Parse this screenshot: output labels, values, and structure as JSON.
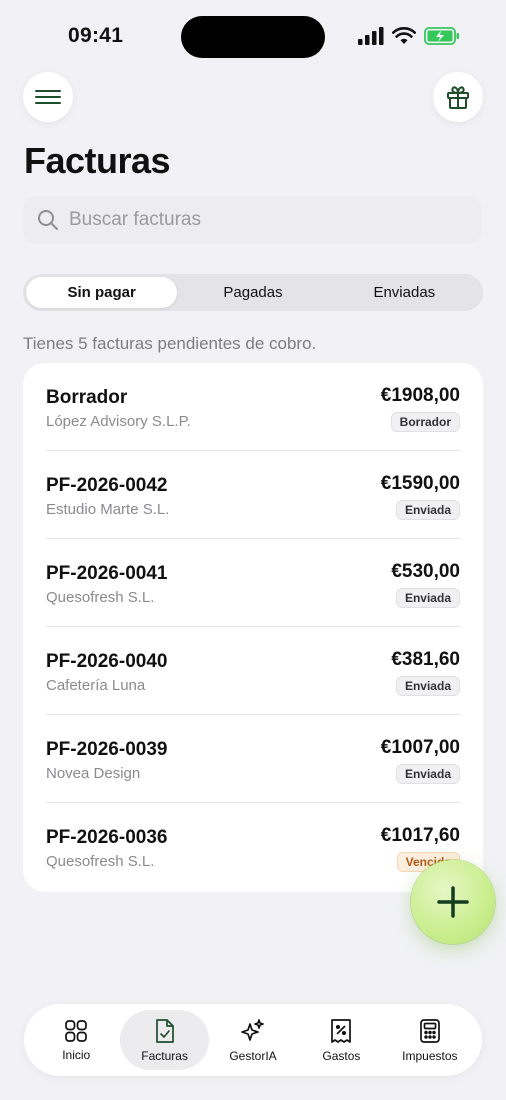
{
  "status_bar": {
    "time": "09:41"
  },
  "header": {
    "title": "Facturas"
  },
  "search": {
    "placeholder": "Buscar facturas"
  },
  "segments": [
    {
      "label": "Sin pagar",
      "active": true
    },
    {
      "label": "Pagadas",
      "active": false
    },
    {
      "label": "Enviadas",
      "active": false
    }
  ],
  "summary_text": "Tienes 5 facturas pendientes de cobro.",
  "invoices": [
    {
      "number": "Borrador",
      "client": "López Advisory S.L.P.",
      "amount": "€1908,00",
      "status": "Borrador"
    },
    {
      "number": "PF-2026-0042",
      "client": "Estudio Marte S.L.",
      "amount": "€1590,00",
      "status": "Enviada"
    },
    {
      "number": "PF-2026-0041",
      "client": "Quesofresh S.L.",
      "amount": "€530,00",
      "status": "Enviada"
    },
    {
      "number": "PF-2026-0040",
      "client": "Cafetería Luna",
      "amount": "€381,60",
      "status": "Enviada"
    },
    {
      "number": "PF-2026-0039",
      "client": "Novea Design",
      "amount": "€1007,00",
      "status": "Enviada"
    },
    {
      "number": "PF-2026-0036",
      "client": "Quesofresh S.L.",
      "amount": "€1017,60",
      "status": "Vencida"
    }
  ],
  "tabbar": [
    {
      "label": "Inicio",
      "icon": "grid-icon",
      "active": false
    },
    {
      "label": "Facturas",
      "icon": "invoice-icon",
      "active": true
    },
    {
      "label": "GestorIA",
      "icon": "sparkles-icon",
      "active": false
    },
    {
      "label": "Gastos",
      "icon": "receipt-icon",
      "active": false
    },
    {
      "label": "Impuestos",
      "icon": "calculator-icon",
      "active": false
    }
  ],
  "colors": {
    "accent": "#c9ee8d",
    "icon_dark": "#1f4d2b",
    "overdue": "#b35a12"
  },
  "battery": {
    "level": 1.0,
    "charging": true
  }
}
